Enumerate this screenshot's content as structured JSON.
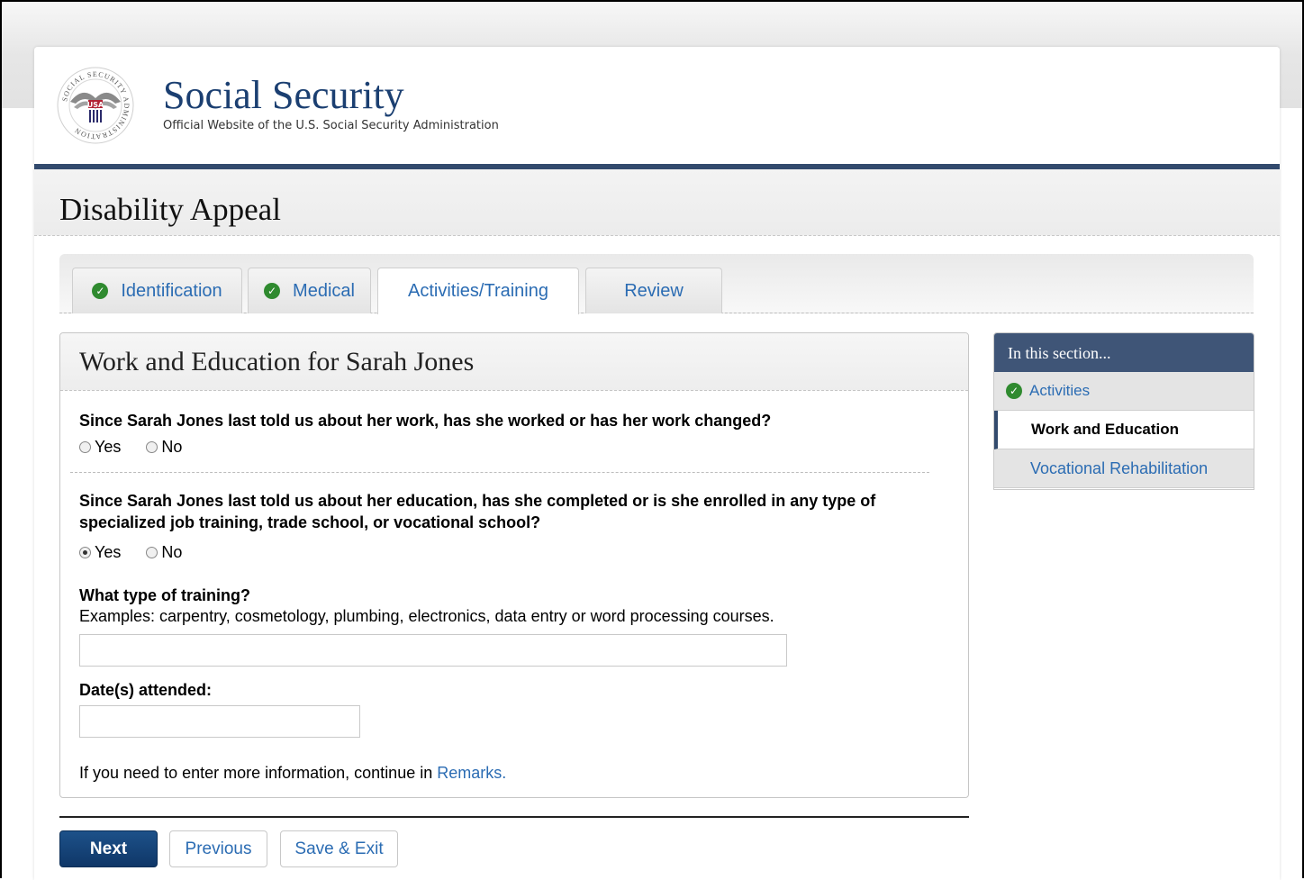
{
  "header": {
    "seal_text": "SOCIAL SECURITY ADMINISTRATION",
    "seal_center": "USA",
    "site_title": "Social Security",
    "site_subtitle": "Official Website of the U.S. Social Security Administration",
    "app_title": "Disability Appeal"
  },
  "tabs": [
    {
      "label": "Identification",
      "completed": true,
      "active": false
    },
    {
      "label": "Medical",
      "completed": true,
      "active": false
    },
    {
      "label": "Activities/Training",
      "completed": false,
      "active": true
    },
    {
      "label": "Review",
      "completed": false,
      "active": false
    }
  ],
  "main": {
    "title": "Work and Education for Sarah Jones",
    "q1": {
      "text": "Since Sarah Jones last told us about her work, has she worked or has her work changed?",
      "options": [
        "Yes",
        "No"
      ],
      "selected": null
    },
    "q2": {
      "text": "Since Sarah Jones last told us about her education, has she completed or is she enrolled in any type of specialized job training, trade school, or vocational school?",
      "options": [
        "Yes",
        "No"
      ],
      "selected": "Yes"
    },
    "training": {
      "label": "What type of training?",
      "help": "Examples: carpentry, cosmetology, plumbing, electronics, data entry or word processing courses.",
      "value": ""
    },
    "dates": {
      "label": "Date(s) attended:",
      "value": ""
    },
    "remarks": {
      "prefix": "If you need to enter more information, continue in ",
      "link": "Remarks",
      "suffix": "."
    }
  },
  "buttons": {
    "next": "Next",
    "previous": "Previous",
    "save_exit": "Save & Exit"
  },
  "sidebar": {
    "heading": "In this section...",
    "items": [
      {
        "label": "Activities",
        "completed": true,
        "current": false
      },
      {
        "label": "Work and Education",
        "completed": false,
        "current": true
      },
      {
        "label": "Vocational Rehabilitation",
        "completed": false,
        "current": false
      }
    ]
  },
  "colors": {
    "brand_blue": "#1b3f71",
    "rule_blue": "#324a6d",
    "link_blue": "#2b6cb3",
    "check_green": "#2f8a2f",
    "primary_button": "#0f3768"
  }
}
